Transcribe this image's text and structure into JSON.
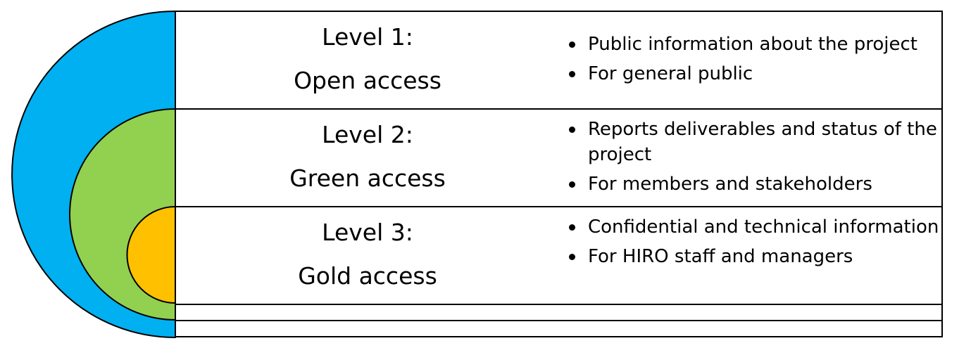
{
  "colors": {
    "outer_ring": "#00b0f0",
    "middle_ring": "#92d050",
    "inner_ring": "#ffc000",
    "border": "#000000",
    "background": "#ffffff"
  },
  "levels": [
    {
      "level_label": "Level 1:",
      "access_name": "Open access",
      "ring_color": "#00b0f0",
      "bullets": [
        "Public information about the project",
        "For general public"
      ]
    },
    {
      "level_label": "Level 2:",
      "access_name": "Green access",
      "ring_color": "#92d050",
      "bullets": [
        "Reports deliverables and status of the project",
        "For members and stakeholders"
      ]
    },
    {
      "level_label": "Level 3:",
      "access_name": "Gold access",
      "ring_color": "#ffc000",
      "bullets": [
        "Confidential and technical information",
        "For HIRO staff and managers"
      ]
    }
  ]
}
